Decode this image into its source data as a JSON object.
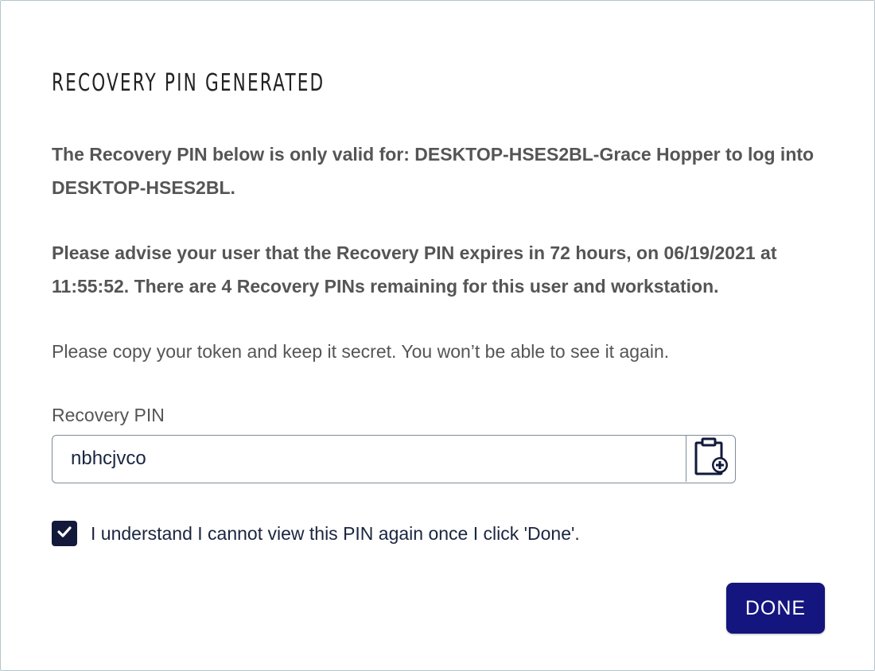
{
  "dialog": {
    "title": "RECOVERY PIN GENERATED",
    "message_validity": "The Recovery PIN below is only valid for: DESKTOP-HSES2BL-Grace Hopper to log into DESKTOP-HSES2BL.",
    "message_expiry": "Please advise your user that the Recovery PIN expires in 72 hours, on 06/19/2021 at 11:55:52. There are 4 Recovery PINs remaining for this user and workstation.",
    "message_copy": "Please copy your token and keep it secret. You won’t be able to see it again.",
    "pin_label": "Recovery PIN",
    "pin_value": "nbhcjvco",
    "copy_icon": "clipboard-add-icon",
    "confirm_checked": true,
    "confirm_label": "I understand I cannot view this PIN again once I click 'Done'.",
    "done_label": "DONE"
  },
  "colors": {
    "accent": "#151580",
    "checkbox": "#12193a",
    "text_dark": "#1a2540",
    "text_muted": "#555555"
  }
}
